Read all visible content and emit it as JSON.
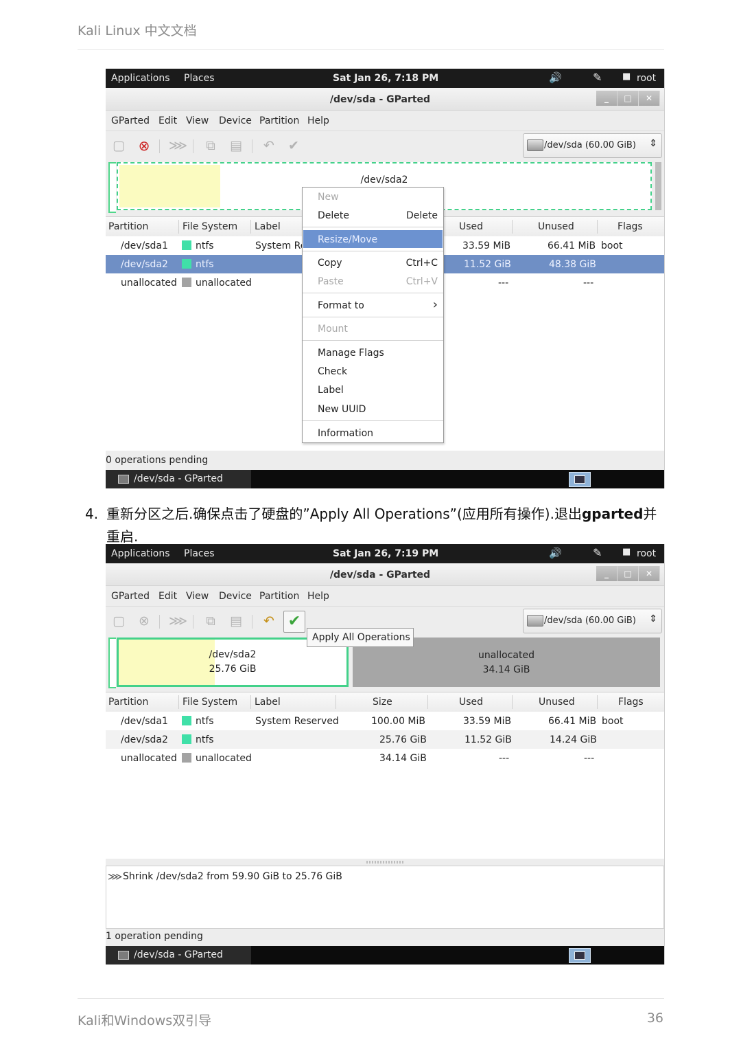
{
  "page": {
    "header": "Kali Linux 中文文档",
    "footer": "Kali和Windows双引导",
    "page_number": "36"
  },
  "caption": {
    "number": "4.",
    "text_pre": "重新分区之后.确保点击了硬盘的”Apply All Operations”(应用所有操作).退出",
    "text_bold": "gparted",
    "text_post": "并重启."
  },
  "shot1": {
    "topbar": {
      "applications": "Applications",
      "places": "Places",
      "clock": "Sat Jan 26,  7:18 PM",
      "user": "root"
    },
    "window_title": "/dev/sda - GParted",
    "menu": [
      "GParted",
      "Edit",
      "View",
      "Device",
      "Partition",
      "Help"
    ],
    "device_selector": "/dev/sda  (60.00 GiB)",
    "partition_map_label": "/dev/sda2",
    "columns": [
      "Partition",
      "File System",
      "Label",
      "Used",
      "Unused",
      "Flags"
    ],
    "rows": [
      {
        "partition": "/dev/sda1",
        "fs": "ntfs",
        "label": "System Re",
        "used": "33.59 MiB",
        "unused": "66.41 MiB",
        "flags": "boot"
      },
      {
        "partition": "/dev/sda2",
        "fs": "ntfs",
        "label": "",
        "used": "11.52 GiB",
        "unused": "48.38 GiB",
        "flags": ""
      },
      {
        "partition": "unallocated",
        "fs": "unallocated",
        "label": "",
        "used": "---",
        "unused": "---",
        "flags": ""
      }
    ],
    "context_menu": {
      "new": "New",
      "delete": "Delete",
      "delete_accel": "Delete",
      "resize": "Resize/Move",
      "copy": "Copy",
      "copy_accel": "Ctrl+C",
      "paste": "Paste",
      "paste_accel": "Ctrl+V",
      "format": "Format to",
      "mount": "Mount",
      "manage_flags": "Manage Flags",
      "check": "Check",
      "label": "Label",
      "new_uuid": "New UUID",
      "information": "Information"
    },
    "status": "0 operations pending",
    "taskbar_label": "/dev/sda - GParted"
  },
  "shot2": {
    "topbar": {
      "applications": "Applications",
      "places": "Places",
      "clock": "Sat Jan 26,  7:19 PM",
      "user": "root"
    },
    "window_title": "/dev/sda - GParted",
    "menu": [
      "GParted",
      "Edit",
      "View",
      "Device",
      "Partition",
      "Help"
    ],
    "device_selector": "/dev/sda  (60.00 GiB)",
    "tooltip": "Apply All Operations",
    "map": {
      "sda2_name": "/dev/sda2",
      "sda2_size": "25.76 GiB",
      "unalloc_name": "unallocated",
      "unalloc_size": "34.14 GiB"
    },
    "columns": [
      "Partition",
      "File System",
      "Label",
      "Size",
      "Used",
      "Unused",
      "Flags"
    ],
    "rows": [
      {
        "partition": "/dev/sda1",
        "fs": "ntfs",
        "label": "System Reserved",
        "size": "100.00 MiB",
        "used": "33.59 MiB",
        "unused": "66.41 MiB",
        "flags": "boot"
      },
      {
        "partition": "/dev/sda2",
        "fs": "ntfs",
        "label": "",
        "size": "25.76 GiB",
        "used": "11.52 GiB",
        "unused": "14.24 GiB",
        "flags": ""
      },
      {
        "partition": "unallocated",
        "fs": "unallocated",
        "label": "",
        "size": "34.14 GiB",
        "used": "---",
        "unused": "---",
        "flags": ""
      }
    ],
    "operation": "Shrink /dev/sda2 from 59.90 GiB to 25.76 GiB",
    "status": "1 operation pending",
    "taskbar_label": "/dev/sda - GParted"
  },
  "icons": {
    "volume": "volume-icon",
    "network": "network-icon",
    "user": "user-icon"
  }
}
